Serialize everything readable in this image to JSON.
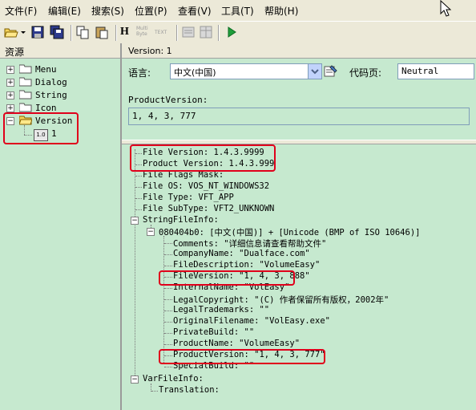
{
  "menu": [
    {
      "label": "文件(F)"
    },
    {
      "label": "编辑(E)"
    },
    {
      "label": "搜索(S)"
    },
    {
      "label": "位置(P)"
    },
    {
      "label": "查看(V)"
    },
    {
      "label": "工具(T)"
    },
    {
      "label": "帮助(H)"
    }
  ],
  "toolbar": {
    "multibyte_label": "Multi Byte",
    "text_label": "TEXT",
    "h_label": "H"
  },
  "left": {
    "header": "资源",
    "items": [
      {
        "label": "Menu"
      },
      {
        "label": "Dialog"
      },
      {
        "label": "String"
      },
      {
        "label": "Icon"
      },
      {
        "label": "Version"
      }
    ],
    "child_icon_text": "1.0",
    "child_label": "1"
  },
  "right": {
    "header": "Version: 1",
    "language_label": "语言:",
    "language_value": "中文(中国)",
    "codepage_label": "代码页:",
    "codepage_value": "Neutral",
    "productversion_label": "ProductVersion:",
    "productversion_value": "1, 4, 3, 777"
  },
  "details": {
    "file_version": "File Version: 1.4.3.9999",
    "product_version": "Product Version: 1.4.3.999",
    "flags_mask": "File Flags Mask:",
    "file_os": "File OS: VOS_NT_WINDOWS32",
    "file_type": "File Type: VFT_APP",
    "file_subtype": "File SubType: VFT2_UNKNOWN",
    "stringfileinfo": "StringFileInfo:",
    "block": "080404b0: [中文(中国)] + [Unicode (BMP of ISO 10646)]",
    "strings": [
      "Comments: \"详细信息请查看帮助文件\"",
      "CompanyName: \"Dualface.com\"",
      "FileDescription: \"VolumeEasy\"",
      "FileVersion: \"1, 4, 3, 888\"",
      "InternalName: \"VolEasy\"",
      "LegalCopyright: \"(C) 作者保留所有版权，2002年\"",
      "LegalTrademarks: \"\"",
      "OriginalFilename: \"VolEasy.exe\"",
      "PrivateBuild: \"\"",
      "ProductName: \"VolumeEasy\"",
      "ProductVersion: \"1, 4, 3, 777\"",
      "SpecialBuild: \"\""
    ],
    "varfileinfo": "VarFileInfo:",
    "translation": "Translation:"
  },
  "colors": {
    "pane_bg": "#c6e9cf",
    "chrome_bg": "#ece9d8",
    "highlight": "#e0001b"
  }
}
